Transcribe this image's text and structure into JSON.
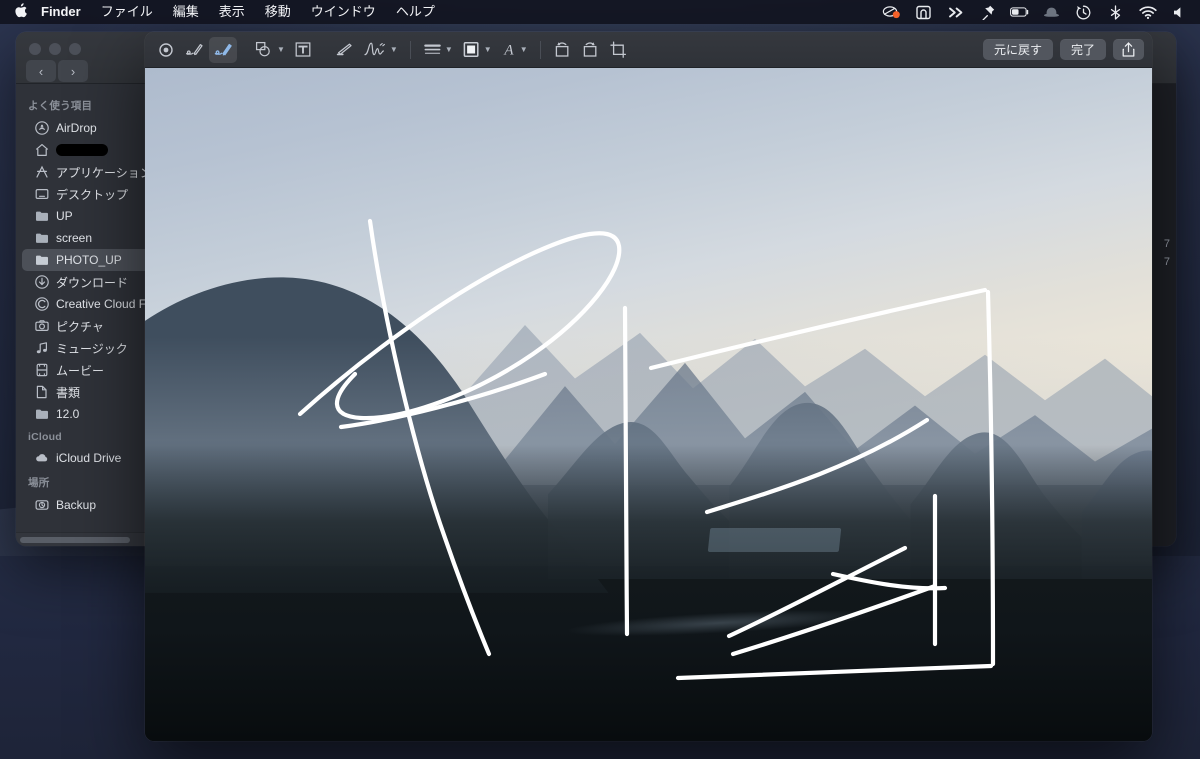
{
  "menubar": {
    "apple_icon": "apple-logo-icon",
    "app_name": "Finder",
    "items": [
      "ファイル",
      "編集",
      "表示",
      "移動",
      "ウインドウ",
      "ヘルプ"
    ],
    "status_icons": [
      {
        "name": "cloud-sync-icon",
        "badge": true,
        "badge_color": "#f4612a"
      },
      {
        "name": "app-window-icon"
      },
      {
        "name": "double-chevron-right-icon"
      },
      {
        "name": "pin-icon"
      },
      {
        "name": "battery-icon"
      },
      {
        "name": "bowler-hat-icon"
      },
      {
        "name": "time-machine-clock-icon"
      },
      {
        "name": "bluetooth-icon"
      },
      {
        "name": "wifi-icon"
      },
      {
        "name": "volume-icon"
      }
    ]
  },
  "finder": {
    "window_controls": [
      "close",
      "minimize",
      "zoom"
    ],
    "nav_back_label": "‹",
    "nav_forward_label": "›",
    "sidebar": {
      "sections": [
        {
          "header": "よく使う項目",
          "items": [
            {
              "label": "AirDrop",
              "icon": "airdrop-icon",
              "selected": false
            },
            {
              "label": "",
              "icon": "home-icon",
              "selected": false,
              "redacted": true
            },
            {
              "label": "アプリケーション",
              "icon": "applications-icon",
              "selected": false
            },
            {
              "label": "デスクトップ",
              "icon": "desktop-icon",
              "selected": false
            },
            {
              "label": "UP",
              "icon": "folder-icon",
              "selected": false
            },
            {
              "label": "screen",
              "icon": "folder-icon",
              "selected": false
            },
            {
              "label": "PHOTO_UP",
              "icon": "folder-icon",
              "selected": true
            },
            {
              "label": "ダウンロード",
              "icon": "downloads-icon",
              "selected": false
            },
            {
              "label": "Creative Cloud Fi",
              "icon": "creative-cloud-icon",
              "selected": false
            },
            {
              "label": "ピクチャ",
              "icon": "pictures-icon",
              "selected": false
            },
            {
              "label": "ミュージック",
              "icon": "music-icon",
              "selected": false
            },
            {
              "label": "ムービー",
              "icon": "movies-icon",
              "selected": false
            },
            {
              "label": "書類",
              "icon": "documents-icon",
              "selected": false
            },
            {
              "label": "12.0",
              "icon": "folder-icon",
              "selected": false
            }
          ]
        },
        {
          "header": "iCloud",
          "items": [
            {
              "label": "iCloud Drive",
              "icon": "icloud-icon",
              "selected": false
            }
          ]
        },
        {
          "header": "場所",
          "items": [
            {
              "label": "Backup",
              "icon": "hard-drive-icon",
              "selected": false
            }
          ]
        }
      ]
    },
    "obscured_column_fragments": [
      "7",
      "7"
    ]
  },
  "quicklook": {
    "toolbar": {
      "tools": [
        {
          "name": "instant-alpha-tool",
          "icon": "target-dot-icon",
          "active": false,
          "has_chevron": false
        },
        {
          "name": "sketch-tool",
          "icon": "sketch-pencil-icon",
          "active": false,
          "has_chevron": false
        },
        {
          "name": "draw-tool",
          "icon": "draw-brush-icon",
          "active": true,
          "has_chevron": false
        },
        {
          "name": "shapes-tool",
          "icon": "shapes-icon",
          "active": false,
          "has_chevron": true
        },
        {
          "name": "text-tool",
          "icon": "text-box-icon",
          "active": false,
          "has_chevron": false
        },
        {
          "name": "highlight-tool",
          "icon": "highlighter-icon",
          "active": false,
          "has_chevron": false
        },
        {
          "name": "signature-tool",
          "icon": "signature-icon",
          "active": false,
          "has_chevron": true
        },
        {
          "name": "shape-style-tool",
          "icon": "line-weight-icon",
          "active": false,
          "has_chevron": true
        },
        {
          "name": "border-color-tool",
          "icon": "filled-square-icon",
          "active": false,
          "has_chevron": true
        },
        {
          "name": "text-style-tool",
          "icon": "letter-a-icon",
          "active": false,
          "has_chevron": true
        },
        {
          "name": "rotate-left-tool",
          "icon": "rotate-left-icon",
          "active": false,
          "has_chevron": false
        },
        {
          "name": "rotate-right-tool",
          "icon": "rotate-right-icon",
          "active": false,
          "has_chevron": false
        },
        {
          "name": "crop-tool",
          "icon": "crop-icon",
          "active": false,
          "has_chevron": false
        }
      ],
      "undo_label": "元に戻す",
      "done_label": "完了",
      "share_icon": "share-upload-icon"
    },
    "image": {
      "description": "misty karst mountain landscape at dusk with river valley",
      "annotation_color": "#ffffff",
      "annotation_stroke_width": 4.5
    }
  },
  "colors": {
    "menubar_bg": "#111420",
    "desktop_bg": "#252d46",
    "window_chrome": "#33363c",
    "sidebar_bg": "#2f3239",
    "sidebar_selected": "#4c5058",
    "accent_blue": "#8fb8e8",
    "button_bg": "#52565e",
    "ink_white": "#ffffff",
    "badge_orange": "#f4612a"
  }
}
